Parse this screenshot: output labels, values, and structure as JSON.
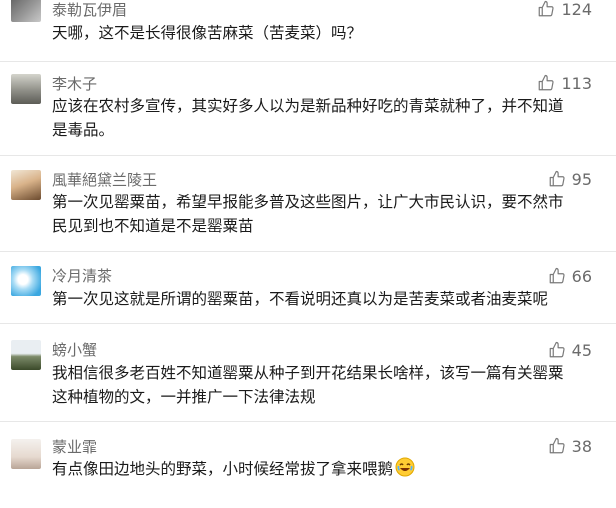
{
  "comments": [
    {
      "user": "泰勒瓦伊眉",
      "likes": "124",
      "lines": [
        "天哪，这不是长得很像苦麻菜（苦麦菜）吗？"
      ]
    },
    {
      "user": "李木子",
      "likes": "113",
      "lines": [
        "应该在农村多宣传，其实好多人以为是新品种好吃的青菜就种了，并不知道",
        "是毒品。"
      ]
    },
    {
      "user": "風華絕黛兰陵王",
      "likes": "95",
      "lines": [
        "第一次见罂粟苗，希望早报能多普及这些图片，让广大市民认识，要不然市",
        "民见到也不知道是不是罂粟苗"
      ]
    },
    {
      "user": "冷月清茶",
      "likes": "66",
      "lines": [
        "第一次见这就是所谓的罂粟苗，不看说明还真以为是苦麦菜或者油麦菜呢"
      ]
    },
    {
      "user": "螃小蟹",
      "likes": "45",
      "lines": [
        "我相信很多老百姓不知道罂粟从种子到开花结果长啥样，该写一篇有关罂粟",
        "这种植物的文，一并推广一下法律法规"
      ]
    },
    {
      "user": "蒙业霏",
      "likes": "38",
      "lines": [
        "有点像田边地头的野菜，小时候经常拔了拿来喂鹅"
      ]
    }
  ],
  "icons": {
    "like": "thumbs-up-icon",
    "emoji": "laughing-emoji-icon"
  }
}
